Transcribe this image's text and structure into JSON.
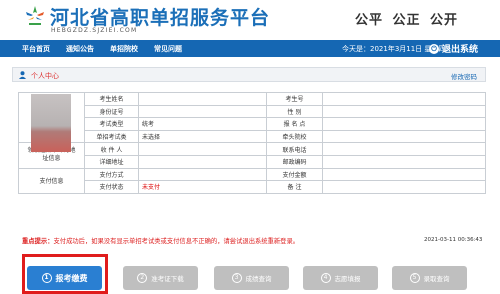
{
  "header": {
    "title": "河北省高职单招服务平台",
    "domain": "HEBGZDZ.SJZIEI.COM",
    "slogan": "公平  公正  公开"
  },
  "nav": {
    "items": [
      "平台首页",
      "通知公告",
      "单招院校",
      "常见问题"
    ],
    "date": "今天是：2021年3月11日 星期四",
    "logout": "退出系统"
  },
  "panel": {
    "title": "个人中心",
    "change_password": "修改密码"
  },
  "info": {
    "name_label": "考生姓名",
    "exam_no_label": "考生号",
    "id_label": "身份证号",
    "gender_label": "性    别",
    "exam_type_label": "考试类型",
    "exam_type_value": "统考",
    "site_label": "报 名 点",
    "category_label": "单招考试类",
    "category_value": "未选择",
    "lead_school_label": "牵头院校",
    "mail_label": "领取通知书邮寄地址信息",
    "recipient_label": "收 件 人",
    "phone_label": "联系电话",
    "address_label": "详细地址",
    "postcode_label": "邮政编码",
    "pay_section_label": "支付信息",
    "pay_method_label": "支付方式",
    "pay_amount_label": "支付金额",
    "pay_status_label": "支付状态",
    "pay_status_value": "未支付",
    "remark_label": "备    注"
  },
  "notice": {
    "prefix": "重点提示：",
    "text": "支付成功后，如果没有显示单招考试类或支付信息不正确的，请尝试退出系统重新登录。",
    "timestamp": "2021-03-11 00:36:43"
  },
  "steps": [
    {
      "num": "1",
      "label": "报考缴费"
    },
    {
      "num": "2",
      "label": "准考证下载"
    },
    {
      "num": "3",
      "label": "成绩查询"
    },
    {
      "num": "4",
      "label": "志愿填报"
    },
    {
      "num": "5",
      "label": "录取查询"
    }
  ],
  "colors": {
    "brand": "#1567b3",
    "accent": "#2a7fd2",
    "warning": "#d22",
    "highlight": "#e01c1c"
  }
}
